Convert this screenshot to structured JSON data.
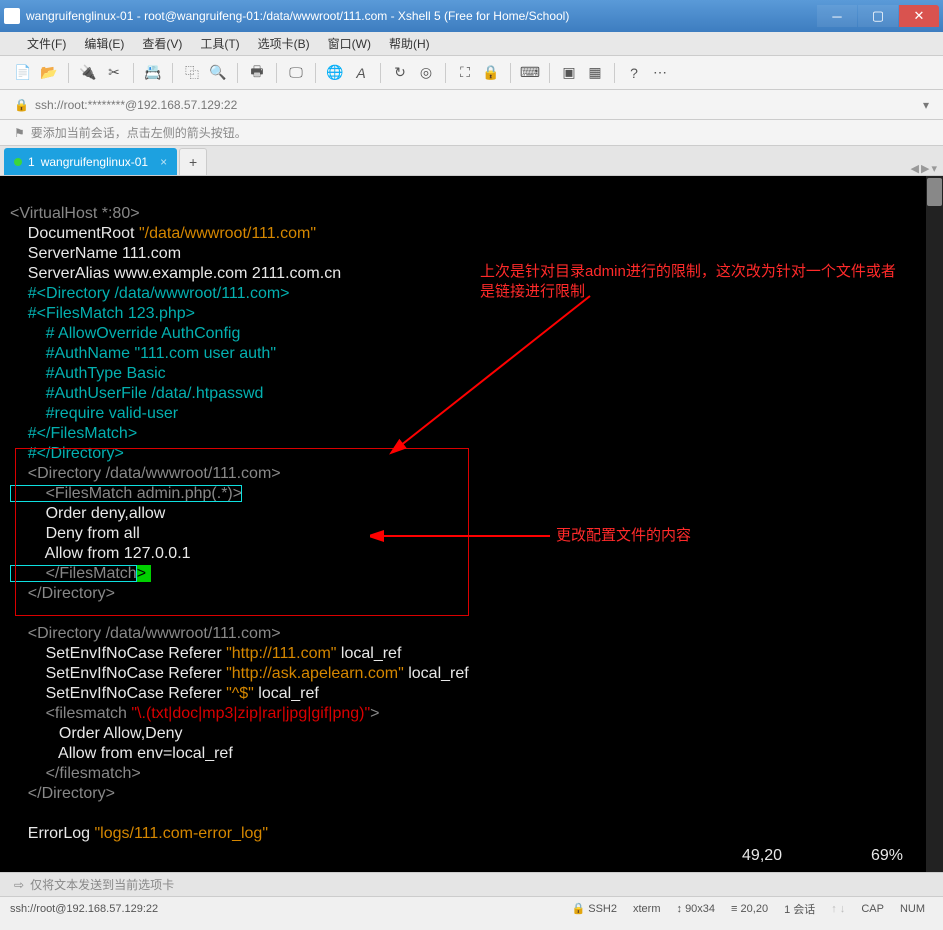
{
  "title": "wangruifenglinux-01 - root@wangruifeng-01:/data/wwwroot/111.com - Xshell 5 (Free for Home/School)",
  "menu": {
    "file": "文件(F)",
    "edit": "编辑(E)",
    "view": "查看(V)",
    "tools": "工具(T)",
    "tabs": "选项卡(B)",
    "window": "窗口(W)",
    "help": "帮助(H)"
  },
  "address": "ssh://root:********@192.168.57.129:22",
  "hint": "要添加当前会话，点击左侧的箭头按钮。",
  "tab": {
    "index": "1",
    "name": "wangruifenglinux-01"
  },
  "annotations": {
    "note1": "上次是针对目录admin进行的限制，这次改为针对一个文件或者是链接进行限制",
    "note2": "更改配置文件的内容"
  },
  "code": {
    "l1a": "<VirtualHost *:80>",
    "l2a": "    DocumentRoot ",
    "l2b": "\"/data/wwwroot/111.com\"",
    "l3a": "    ServerName 111.com",
    "l4a": "    ServerAlias www.example.com 2111.com.cn",
    "l5a": "    #<Directory /data/wwwroot/111.com>",
    "l6a": "    #<FilesMatch 123.php>",
    "l7a": "        # AllowOverride AuthConfig",
    "l8a": "        #AuthName \"111.com user auth\"",
    "l9a": "        #AuthType Basic",
    "l10a": "        #AuthUserFile /data/.htpasswd",
    "l11a": "        #require valid-user",
    "l12a": "    #</FilesMatch>",
    "l13a": "    #</Directory>",
    "l14a": "    <Directory /data/wwwroot/111.com>",
    "l15a": "        <FilesMatch admin.php(.*)>",
    "l16a": "        Order deny,allow",
    "l17a": "        Deny from all",
    "l18a": "        Allow from 127.0.0.1",
    "l19a": "        </FilesMatch",
    "l19b": ">",
    "l20a": "    </Directory>",
    "l22a": "    <Directory /data/wwwroot/111.com>",
    "l23a": "        SetEnvIfNoCase Referer ",
    "l23b": "\"http://111.com\"",
    "l23c": " local_ref",
    "l24a": "        SetEnvIfNoCase Referer ",
    "l24b": "\"http://ask.apelearn.com\"",
    "l24c": " local_ref",
    "l25a": "        SetEnvIfNoCase Referer ",
    "l25b": "\"^$\"",
    "l25c": " local_ref",
    "l26a": "        <filesmatch ",
    "l26b": "\"\\.(txt|doc|mp3|zip|rar|jpg|gif|png)\"",
    "l26c": ">",
    "l27a": "           Order Allow,Deny",
    "l28a": "           Allow from env=local_ref",
    "l29a": "        </filesmatch>",
    "l30a": "    </Directory>",
    "l32a": "    ErrorLog ",
    "l32b": "\"logs/111.com-error_log\"",
    "pos": "49,20",
    "pct": "69%"
  },
  "bottom_hint": "仅将文本发送到当前选项卡",
  "status": {
    "conn": "ssh://root@192.168.57.129:22",
    "ssh": "SSH2",
    "term": "xterm",
    "size": "90x34",
    "cursor": "20,20",
    "sess": "1 会话",
    "cap": "CAP",
    "num": "NUM"
  },
  "icons": {
    "lock": "🔒",
    "flag": "⚑",
    "copy": "⿻",
    "search": "🔍",
    "arrow": "▾",
    "check": "✓"
  }
}
